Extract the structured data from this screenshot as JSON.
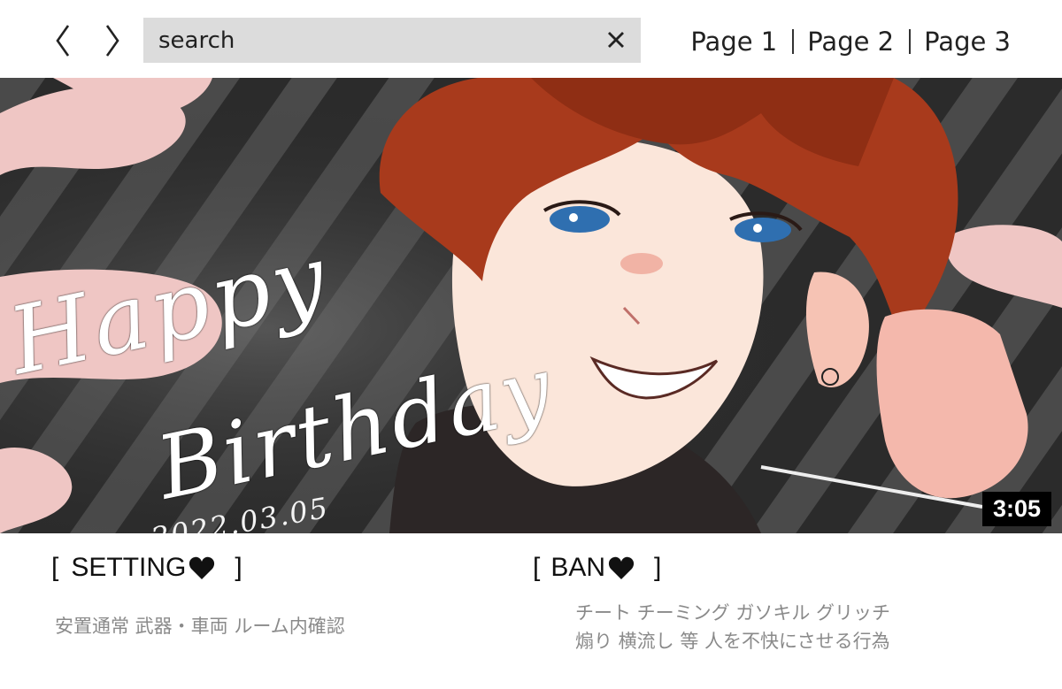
{
  "toolbar": {
    "back_icon": "chevron-left-icon",
    "forward_icon": "chevron-right-icon"
  },
  "search": {
    "placeholder": "search",
    "clear_icon": "close-icon"
  },
  "pagination": [
    "Page 1",
    "Page 2",
    "Page 3"
  ],
  "banner": {
    "line1": "Happy",
    "line2": "Birthday",
    "date": "2022.03.05",
    "duration": "3:05"
  },
  "setting": {
    "title": "SETTING",
    "bracket_open": "[",
    "bracket_close": "]",
    "heart_icon": "heart-icon",
    "body": "安置通常  武器・車両  ルーム内確認"
  },
  "ban": {
    "title": "BAN",
    "bracket_open": "[",
    "bracket_close": "]",
    "heart_icon": "heart-icon",
    "line1": "チート  チーミング  ガソキル  グリッチ",
    "line2": "煽り  横流し  等  人を不快にさせる行為"
  },
  "colors": {
    "search_bg": "#dcdcdc",
    "stripe_dark": "#2b2b2b",
    "stripe_light": "#4a4a4a",
    "smoke_pink": "#efc6c4",
    "hair": "#a83a1c",
    "skin": "#fbe6da",
    "eye": "#2f6fb0"
  }
}
